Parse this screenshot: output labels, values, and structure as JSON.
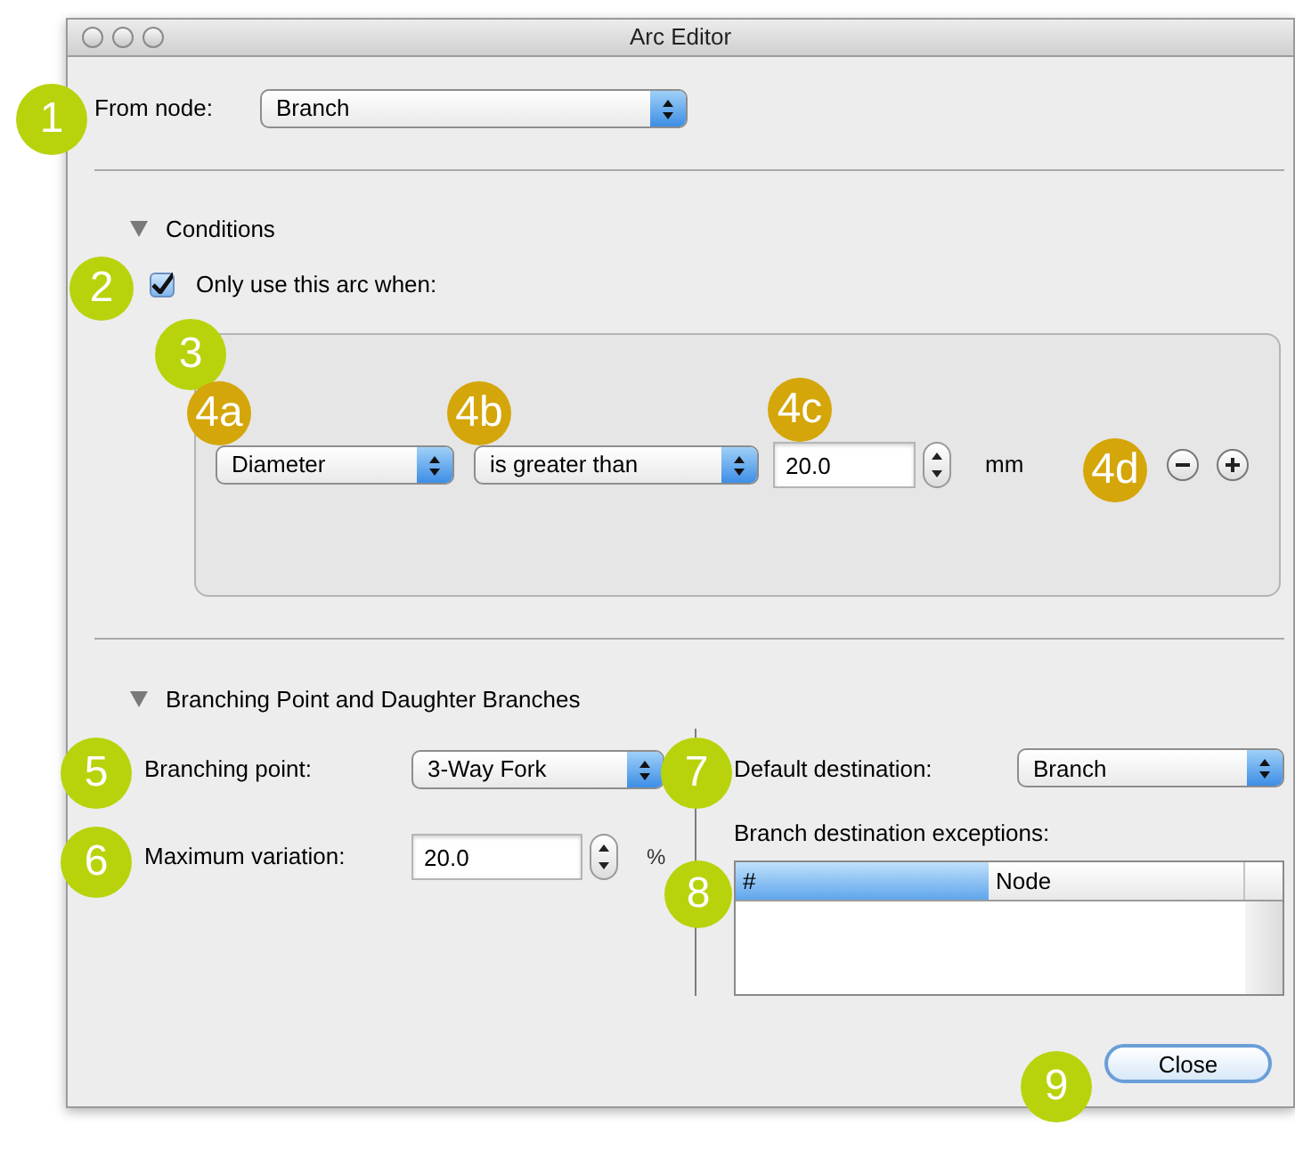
{
  "window": {
    "title": "Arc Editor"
  },
  "from_node": {
    "label": "From node:",
    "value": "Branch"
  },
  "conditions": {
    "title": "Conditions",
    "expanded": true,
    "enabled": {
      "label": "Only use this arc when:",
      "checked": true
    },
    "rows": [
      {
        "attribute": "Diameter",
        "operator": "is greater than",
        "value": "20.0",
        "unit": "mm"
      }
    ]
  },
  "branching": {
    "title": "Branching Point and Daughter Branches",
    "expanded": true,
    "branching_point": {
      "label": "Branching point:",
      "value": "3-Way Fork"
    },
    "maximum_variation": {
      "label": "Maximum variation:",
      "value": "20.0",
      "unit": "%"
    },
    "default_destination": {
      "label": "Default destination:",
      "value": "Branch"
    },
    "exceptions": {
      "label": "Branch destination exceptions:",
      "columns": [
        {
          "label": "#",
          "selected": true
        },
        {
          "label": "Node",
          "selected": false
        }
      ]
    }
  },
  "buttons": [
    {
      "label": "Close",
      "default": true
    }
  ],
  "callouts": [
    {
      "label": "1",
      "color": "#b8d30c"
    },
    {
      "label": "2",
      "color": "#b8d30c"
    },
    {
      "label": "3",
      "color": "#b8d30c"
    },
    {
      "label": "4a",
      "color": "#d4a60a"
    },
    {
      "label": "4b",
      "color": "#d4a60a"
    },
    {
      "label": "4c",
      "color": "#d4a60a"
    },
    {
      "label": "4d",
      "color": "#d4a60a"
    },
    {
      "label": "5",
      "color": "#b8d30c"
    },
    {
      "label": "6",
      "color": "#b8d30c"
    },
    {
      "label": "7",
      "color": "#b8d30c"
    },
    {
      "label": "8",
      "color": "#b8d30c"
    },
    {
      "label": "9",
      "color": "#b8d30c"
    }
  ]
}
